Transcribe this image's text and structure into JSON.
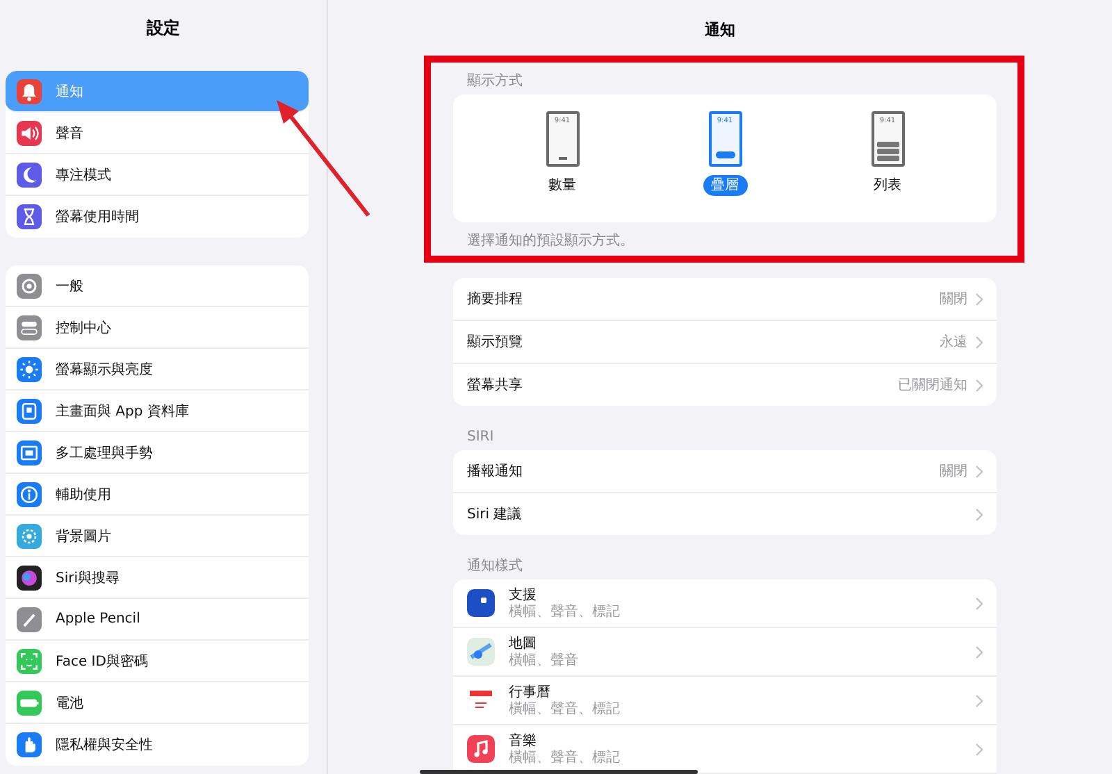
{
  "sidebar": {
    "title": "設定",
    "groups": [
      [
        {
          "label": "通知",
          "selected": true
        },
        {
          "label": "聲音",
          "selected": false
        },
        {
          "label": "專注模式",
          "selected": false
        },
        {
          "label": "螢幕使用時間",
          "selected": false
        }
      ],
      [
        {
          "label": "一般",
          "selected": false
        },
        {
          "label": "控制中心",
          "selected": false
        },
        {
          "label": "螢幕顯示與亮度",
          "selected": false
        },
        {
          "label": "主畫面與 App 資料庫",
          "selected": false
        },
        {
          "label": "多工處理與手勢",
          "selected": false
        },
        {
          "label": "輔助使用",
          "selected": false
        },
        {
          "label": "背景圖片",
          "selected": false
        },
        {
          "label": "Siri與搜尋",
          "selected": false
        },
        {
          "label": "Apple Pencil",
          "selected": false
        },
        {
          "label": "Face ID與密碼",
          "selected": false
        },
        {
          "label": "電池",
          "selected": false
        },
        {
          "label": "隱私權與安全性",
          "selected": false
        }
      ]
    ]
  },
  "detail": {
    "title": "通知",
    "display_style": {
      "header": "顯示方式",
      "footer": "選擇通知的預設顯示方式。",
      "options": [
        {
          "kind": "count",
          "label": "數量",
          "preview_time": "9:41",
          "selected": false
        },
        {
          "kind": "stack",
          "label": "疊層",
          "preview_time": "9:41",
          "selected": true
        },
        {
          "kind": "list",
          "label": "列表",
          "preview_time": "9:41",
          "selected": false
        }
      ]
    },
    "general_rows": [
      {
        "label": "摘要排程",
        "value": "關閉"
      },
      {
        "label": "顯示預覽",
        "value": "永遠"
      },
      {
        "label": "螢幕共享",
        "value": "已關閉通知"
      }
    ],
    "siri": {
      "header": "SIRI",
      "rows": [
        {
          "label": "播報通知",
          "value": "關閉"
        },
        {
          "label": "Siri 建議"
        }
      ]
    },
    "notification_style": {
      "header": "通知樣式",
      "apps": [
        {
          "name": "支援",
          "detail": "橫幅、聲音、標記"
        },
        {
          "name": "地圖",
          "detail": "橫幅、聲音"
        },
        {
          "name": "行事曆",
          "detail": "橫幅、聲音、標記"
        },
        {
          "name": "音樂",
          "detail": "橫幅、聲音、標記"
        }
      ]
    }
  }
}
